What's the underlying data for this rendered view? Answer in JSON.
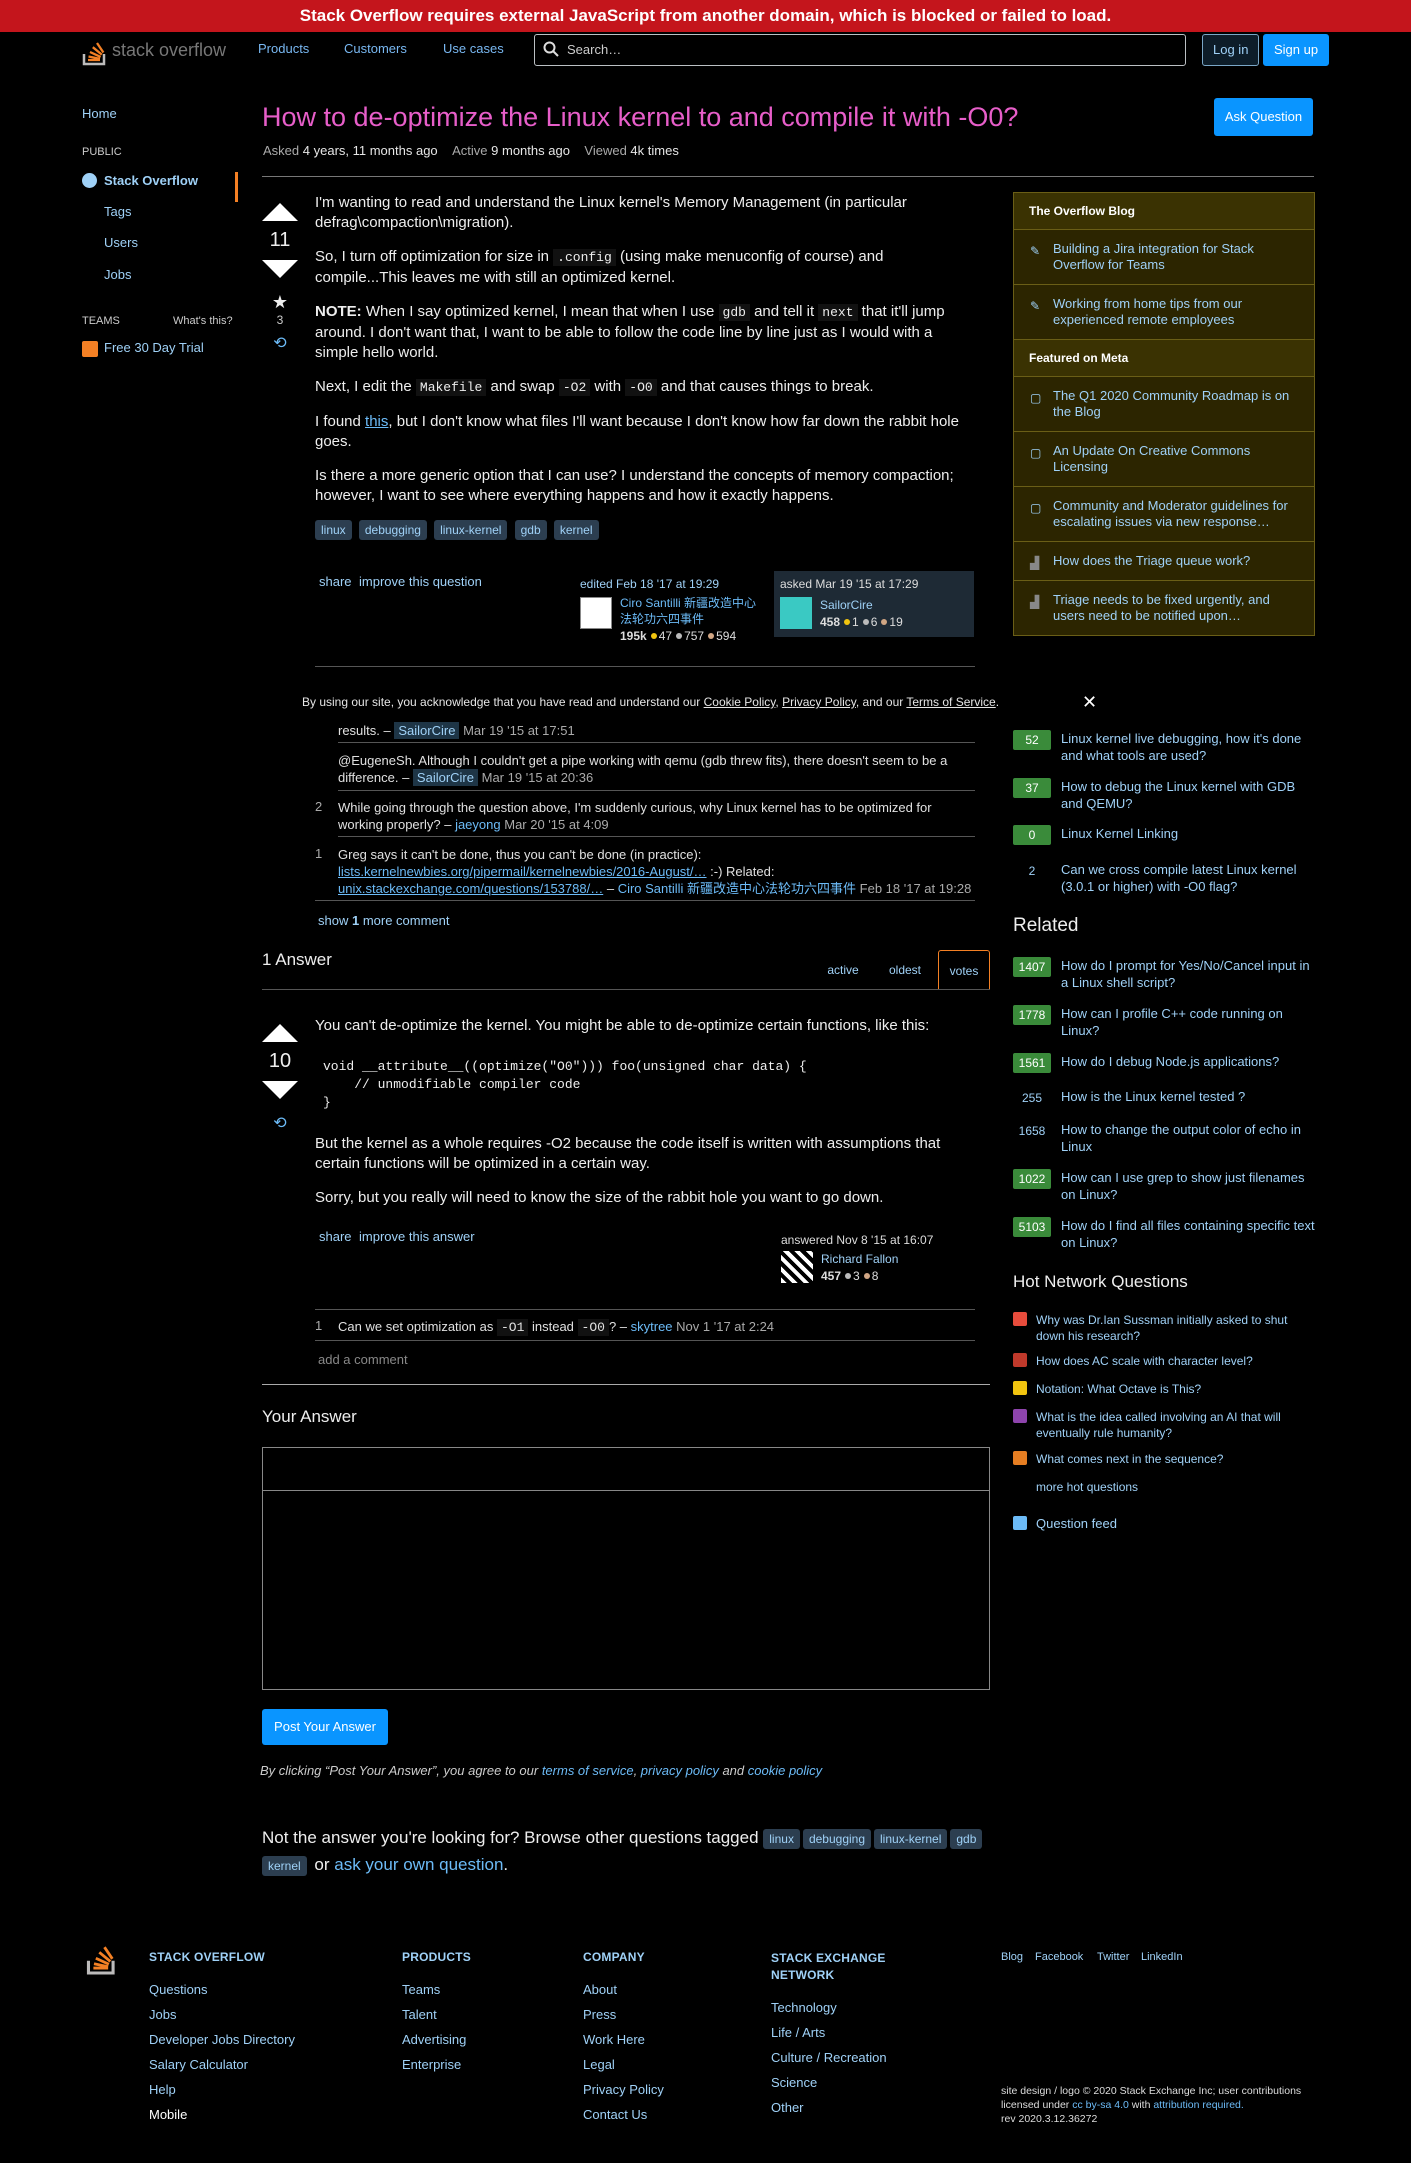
{
  "banner": "Stack Overflow requires external JavaScript from another domain, which is blocked or failed to load.",
  "header": {
    "logo": "stack overflow",
    "nav": [
      "Products",
      "Customers",
      "Use cases"
    ],
    "search_placeholder": "Search…",
    "login": "Log in",
    "signup": "Sign up"
  },
  "leftnav": {
    "home": "Home",
    "public": "PUBLIC",
    "stackoverflow": "Stack Overflow",
    "tags": "Tags",
    "users": "Users",
    "jobs": "Jobs",
    "teams": "TEAMS",
    "whats_this": "What's this?",
    "trial": "Free 30 Day Trial"
  },
  "question": {
    "title": "How to de-optimize the Linux kernel to and compile it with -O0?",
    "ask_button": "Ask Question",
    "asked_label": "Asked",
    "asked": "4 years, 11 months ago",
    "active_label": "Active",
    "active": "9 months ago",
    "viewed_label": "Viewed",
    "viewed": "4k times",
    "votes": "11",
    "favorites": "3",
    "p1": "I'm wanting to read and understand the Linux kernel's Memory Management (in particular defrag\\compaction\\migration).",
    "p2a": "So, I turn off optimization for size in ",
    "p2code": ".config",
    "p2b": " (using make menuconfig of course) and compile...This leaves me with still an optimized kernel.",
    "p3label": "NOTE:",
    "p3a": " When I say optimized kernel, I mean that when I use ",
    "p3code1": "gdb",
    "p3b": " and tell it ",
    "p3code2": "next",
    "p3c": " that it'll jump around. I don't want that, I want to be able to follow the code line by line just as I would with a simple hello world.",
    "p4a": "Next, I edit the ",
    "p4code1": "Makefile",
    "p4b": " and swap ",
    "p4code2": "-O2",
    "p4c": " with ",
    "p4code3": "-O0",
    "p4d": " and that causes things to break.",
    "p5a": "I found ",
    "p5link": "this",
    "p5b": ", but I don't know what files I'll want because I don't know how far down the rabbit hole goes.",
    "p6": "Is there a more generic option that I can use? I understand the concepts of memory compaction; however, I want to see where everything happens and how it exactly happens.",
    "tags": [
      "linux",
      "debugging",
      "linux-kernel",
      "gdb",
      "kernel"
    ],
    "share": "share",
    "improve": "improve this question",
    "edited": "edited Feb 18 '17 at 19:29",
    "editor": "Ciro Santilli 新疆改造中心法轮功六四事件",
    "editor_rep": "195k",
    "editor_gold": "47",
    "editor_silver": "757",
    "editor_bronze": "594",
    "asked_sig": "asked Mar 19 '15 at 17:29",
    "asker": "SailorCire",
    "asker_rep": "458",
    "asker_gold": "1",
    "asker_silver": "6",
    "asker_bronze": "19"
  },
  "cookie": {
    "a": "By using our site, you acknowledge that you have read and understand our ",
    "cookie": "Cookie Policy",
    ",": ", ",
    "privacy": "Privacy Policy",
    "and": ", and our ",
    "terms": "Terms of Service",
    "end": "."
  },
  "comments": [
    {
      "text": "results. – ",
      "user": "SailorCire",
      "time": "Mar 19 '15 at 17:51"
    },
    {
      "text": "@EugeneSh. Although I couldn't get a pipe working with qemu (gdb threw fits), there doesn't seem to be a difference. – ",
      "user": "SailorCire",
      "time": "Mar 19 '15 at 20:36"
    },
    {
      "num": "2",
      "text": "While going through the question above, I'm suddenly curious, why Linux kernel has to be optimized for working properly? – ",
      "user": "jaeyong",
      "time": "Mar 20 '15 at 4:09"
    },
    {
      "num": "1",
      "text": "Greg says it can't be done, thus you can't be done (in practice): ",
      "link1": "lists.kernelnewbies.org/pipermail/kernelnewbies/2016-August/…",
      "mid": " :-) Related: ",
      "link2": "unix.stackexchange.com/questions/153788/…",
      "user": "Ciro Santilli 新疆改造中心法轮功六四事件",
      "time": "Feb 18 '17 at 19:28"
    }
  ],
  "show_more": {
    "a": "show ",
    "n": "1",
    "b": " more comment"
  },
  "answers_header": "1 Answer",
  "tabs": [
    "active",
    "oldest",
    "votes"
  ],
  "answer": {
    "votes": "10",
    "p1": "You can't de-optimize the kernel. You might be able to de-optimize certain functions, like this:",
    "code": "void __attribute__((optimize(\"O0\"))) foo(unsigned char data) {\n    // unmodifiable compiler code\n}",
    "p2": "But the kernel as a whole requires -O2 because the code itself is written with assumptions that certain functions will be optimized in a certain way.",
    "p3": "Sorry, but you really will need to know the size of the rabbit hole you want to go down.",
    "share": "share",
    "improve": "improve this answer",
    "answered": "answered Nov 8 '15 at 16:07",
    "user": "Richard Fallon",
    "rep": "457",
    "silver": "3",
    "bronze": "8",
    "comment_num": "1",
    "comment_a": "Can we set optimization as ",
    "comment_code1": "-O1",
    "comment_b": " instead ",
    "comment_code2": "-O0",
    "comment_c": "? – ",
    "comment_user": "skytree",
    "comment_time": "Nov 1 '17 at 2:24",
    "add_comment": "add a comment"
  },
  "your_answer": "Your Answer",
  "post_button": "Post Your Answer",
  "agree": {
    "a": "By clicking “Post Your Answer”, you agree to our ",
    "tos": "terms of service",
    ",": ", ",
    "privacy": "privacy policy",
    "and": " and ",
    "cookie": "cookie policy"
  },
  "notanswer": {
    "a": "Not the answer you're looking for? Browse other questions tagged ",
    "or": " or ",
    "ask": "ask your own question",
    "end": "."
  },
  "sidebar": {
    "blog_header": "The Overflow Blog",
    "blog": [
      "Building a Jira integration for Stack Overflow for Teams",
      "Working from home tips from our experienced remote employees"
    ],
    "meta_header": "Featured on Meta",
    "meta": [
      "The Q1 2020 Community Roadmap is on the Blog",
      "An Update On Creative Commons Licensing",
      "Community and Moderator guidelines for escalating issues via new response…",
      "How does the Triage queue work?",
      "Triage needs to be fixed urgently, and users need to be notified upon…"
    ]
  },
  "linked": [
    {
      "score": "52",
      "text": "Linux kernel live debugging, how it's done and what tools are used?",
      "green": true
    },
    {
      "score": "37",
      "text": "How to debug the Linux kernel with GDB and QEMU?",
      "green": true
    },
    {
      "score": "0",
      "text": "Linux Kernel Linking",
      "green": true
    },
    {
      "score": "2",
      "text": "Can we cross compile latest Linux kernel (3.0.1 or higher) with -O0 flag?",
      "green": false
    }
  ],
  "related_header": "Related",
  "related": [
    {
      "score": "1407",
      "text": "How do I prompt for Yes/No/Cancel input in a Linux shell script?",
      "green": true
    },
    {
      "score": "1778",
      "text": "How can I profile C++ code running on Linux?",
      "green": true
    },
    {
      "score": "1561",
      "text": "How do I debug Node.js applications?",
      "green": true
    },
    {
      "score": "255",
      "text": "How is the Linux kernel tested ?",
      "green": false
    },
    {
      "score": "1658",
      "text": "How to change the output color of echo in Linux",
      "green": false
    },
    {
      "score": "1022",
      "text": "How can I use grep to show just filenames on Linux?",
      "green": true
    },
    {
      "score": "5103",
      "text": "How do I find all files containing specific text on Linux?",
      "green": true
    }
  ],
  "hot_header": "Hot Network Questions",
  "hot": [
    "Why was Dr.Ian Sussman initially asked to shut down his research?",
    "How does AC scale with character level?",
    "Notation: What Octave is This?",
    "What is the idea called involving an AI that will eventually rule humanity?",
    "What comes next in the sequence?"
  ],
  "hot_colors": [
    "#e74c3c",
    "#c0392b",
    "#f1c40f",
    "#8e44ad",
    "#e67e22"
  ],
  "more_hot": "more hot questions",
  "feed": "Question feed",
  "footer": {
    "so_h": "STACK OVERFLOW",
    "so": [
      "Questions",
      "Jobs",
      "Developer Jobs Directory",
      "Salary Calculator",
      "Help",
      "Mobile"
    ],
    "prod_h": "PRODUCTS",
    "prod": [
      "Teams",
      "Talent",
      "Advertising",
      "Enterprise"
    ],
    "comp_h": "COMPANY",
    "comp": [
      "About",
      "Press",
      "Work Here",
      "Legal",
      "Privacy Policy",
      "Contact Us"
    ],
    "sen_h": "STACK EXCHANGE NETWORK",
    "sen": [
      "Technology",
      "Life / Arts",
      "Culture / Recreation",
      "Science",
      "Other"
    ],
    "social": [
      "Blog",
      "Facebook",
      "Twitter",
      "LinkedIn"
    ],
    "legal1": "site design / logo © 2020 Stack Exchange Inc; user contributions licensed under ",
    "cc": "cc by-sa 4.0",
    "with": " with ",
    "attr": "attribution required.",
    "rev": "rev 2020.3.12.36272"
  }
}
